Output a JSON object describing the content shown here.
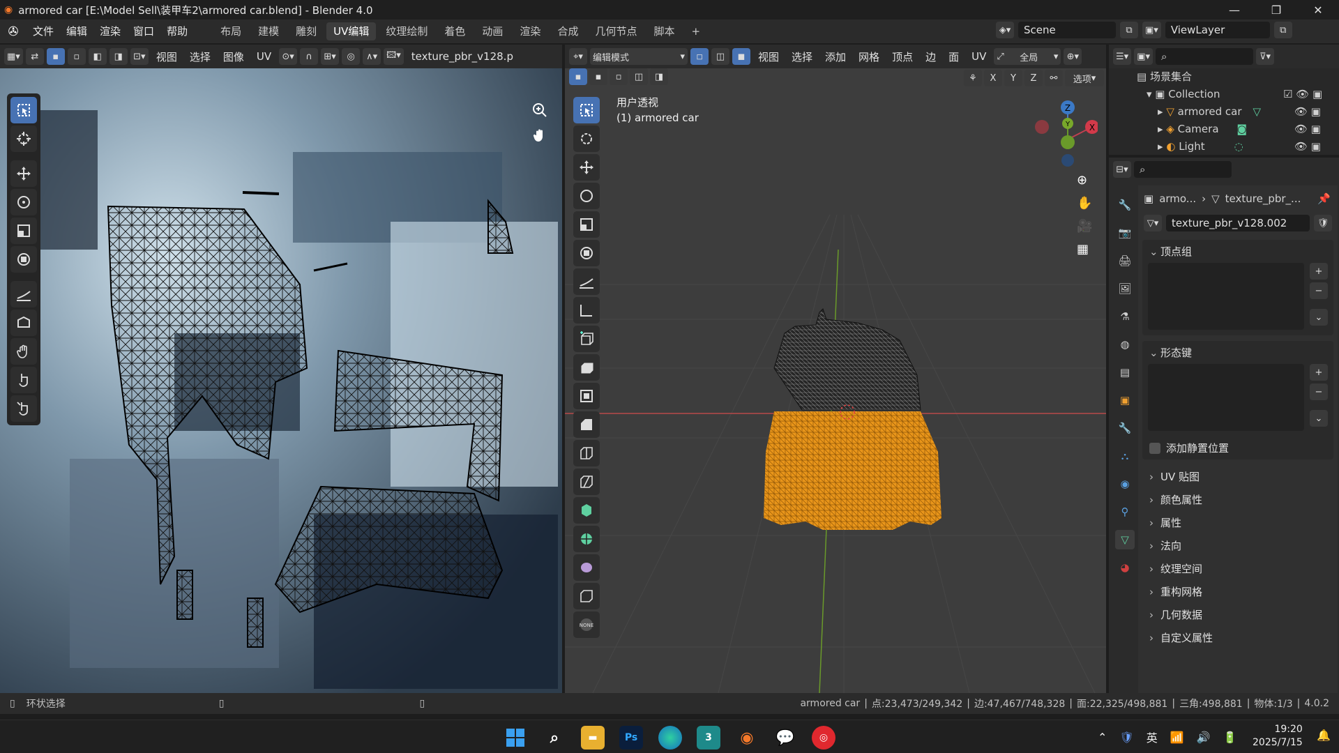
{
  "window": {
    "title": "armored car [E:\\Model Sell\\装甲车2\\armored car.blend] - Blender 4.0"
  },
  "menu": [
    "文件",
    "编辑",
    "渲染",
    "窗口",
    "帮助"
  ],
  "workspaces": [
    "布局",
    "建模",
    "雕刻",
    "UV编辑",
    "纹理绘制",
    "着色",
    "动画",
    "渲染",
    "合成",
    "几何节点",
    "脚本"
  ],
  "scene": {
    "name": "Scene",
    "view_layer": "ViewLayer"
  },
  "uv_editor": {
    "menus": [
      "视图",
      "选择",
      "图像",
      "UV"
    ],
    "image_name": "texture_pbr_v128.p"
  },
  "viewport": {
    "mode": "编辑模式",
    "menus": [
      "视图",
      "选择",
      "添加",
      "网格",
      "顶点",
      "边",
      "面",
      "UV"
    ],
    "transform_orient": "全局",
    "axes": [
      "X",
      "Y",
      "Z"
    ],
    "options_label": "选项",
    "overlay_title": "用户透视",
    "overlay_object": "(1) armored car",
    "gizmo": {
      "z": "Z",
      "y": "Y",
      "x": "X"
    },
    "none_label": "NONE"
  },
  "outliner": {
    "root": "场景集合",
    "collection": "Collection",
    "items": [
      {
        "name": "armored car"
      },
      {
        "name": "Camera"
      },
      {
        "name": "Light"
      }
    ]
  },
  "properties": {
    "breadcrumb_obj": "armo...",
    "breadcrumb_data": "texture_pbr_...",
    "mesh_name": "texture_pbr_v128.002",
    "vertex_groups": "顶点组",
    "shape_keys": "形态键",
    "rest_position": "添加静置位置",
    "sections": [
      "UV 贴图",
      "颜色属性",
      "属性",
      "法向",
      "纹理空间",
      "重构网格",
      "几何数据",
      "自定义属性"
    ]
  },
  "statusbar": {
    "left_action": "环状选择",
    "object": "armored car",
    "verts": "点:23,473/249,342",
    "edges": "边:47,467/748,328",
    "faces": "面:22,325/498,881",
    "tris": "三角:498,881",
    "objects": "物体:1/3",
    "version": "4.0.2"
  },
  "taskbar": {
    "ime": "英",
    "time": "19:20",
    "date": "2025/7/15",
    "ps_label": "Ps"
  },
  "colors": {
    "accent": "#4772b3",
    "selected_mesh": "#f0a030"
  }
}
